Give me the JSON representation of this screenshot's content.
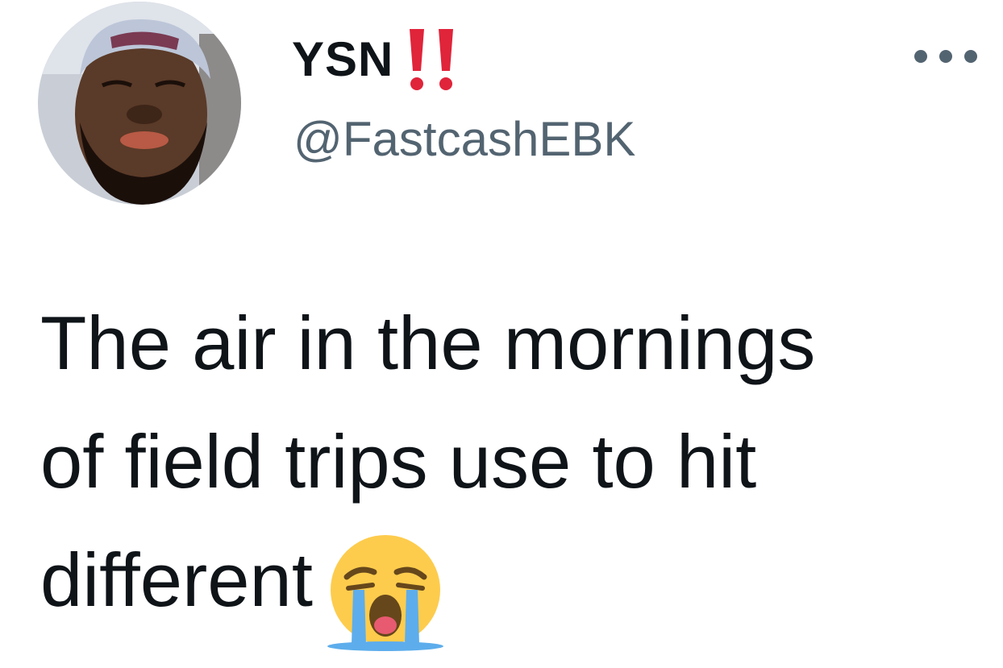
{
  "tweet": {
    "author": {
      "display_name": "YSN",
      "name_emoji": "double-exclamation-icon",
      "handle": "@FastcashEBK",
      "avatar": "avatar-photo"
    },
    "more_menu_icon": "more-horizontal-icon",
    "text_lines": [
      "The air in the mornings",
      "of field trips use to hit",
      "different"
    ],
    "text_emoji": "loudly-crying-face-icon"
  },
  "colors": {
    "text": "#0f1419",
    "secondary_text": "#536471",
    "exclamation_red": "#e0243a",
    "emoji_yellow": "#fdcc4d",
    "tear_blue": "#5dadec"
  }
}
